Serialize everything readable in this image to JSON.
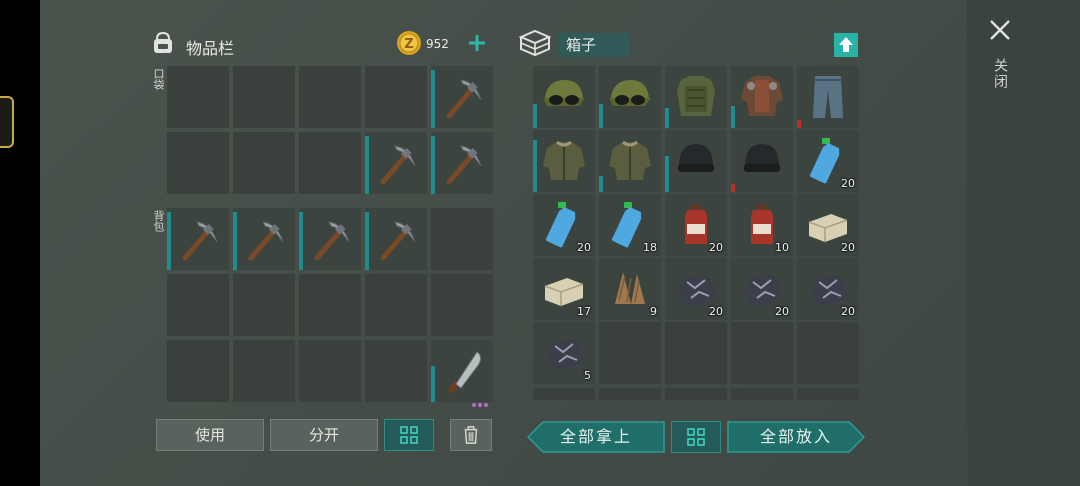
{
  "inventory": {
    "title": "物品栏",
    "coins": "952",
    "pocket_label": "口袋",
    "backpack_label": "背包",
    "pocket_slots": [
      "",
      "",
      "",
      "",
      "pickaxe-icon",
      "",
      "",
      "",
      "pickaxe-icon",
      "pickaxe-icon"
    ],
    "backpack_slots": [
      "pickaxe-icon",
      "pickaxe-icon",
      "pickaxe-icon",
      "pickaxe-icon",
      "",
      "",
      "",
      "",
      "",
      "",
      "",
      "",
      "",
      "",
      "machete-icon"
    ]
  },
  "container": {
    "name": "箱子",
    "items": [
      {
        "icon": "cap-with-goggles-icon",
        "qty": ""
      },
      {
        "icon": "cap-with-goggles-icon",
        "qty": ""
      },
      {
        "icon": "camo-vest-icon",
        "qty": ""
      },
      {
        "icon": "leather-armor-jacket-icon",
        "qty": ""
      },
      {
        "icon": "jeans-icon",
        "qty": ""
      },
      {
        "icon": "olive-jacket-icon",
        "qty": ""
      },
      {
        "icon": "olive-jacket-icon",
        "qty": ""
      },
      {
        "icon": "black-beanie-icon",
        "qty": ""
      },
      {
        "icon": "black-beanie-icon",
        "qty": ""
      },
      {
        "icon": "water-bottle-icon",
        "qty": "20"
      },
      {
        "icon": "water-bottle-icon",
        "qty": "20"
      },
      {
        "icon": "water-bottle-icon",
        "qty": "18"
      },
      {
        "icon": "red-potion-icon",
        "qty": "20"
      },
      {
        "icon": "red-potion-icon",
        "qty": "10"
      },
      {
        "icon": "stone-block-icon",
        "qty": "20"
      },
      {
        "icon": "stone-block-icon",
        "qty": "17"
      },
      {
        "icon": "plant-fiber-icon",
        "qty": "9"
      },
      {
        "icon": "iron-ore-icon",
        "qty": "20"
      },
      {
        "icon": "iron-ore-icon",
        "qty": "20"
      },
      {
        "icon": "iron-ore-icon",
        "qty": "20"
      },
      {
        "icon": "iron-ore-icon",
        "qty": "5"
      }
    ]
  },
  "buttons": {
    "use": "使用",
    "split": "分开",
    "take_all": "全部拿上",
    "put_all": "全部放入",
    "close": "关闭"
  },
  "colors": {
    "accent": "#27b3a5",
    "durability_bar": "#1f8d8e",
    "low_durability": "#b33228"
  }
}
